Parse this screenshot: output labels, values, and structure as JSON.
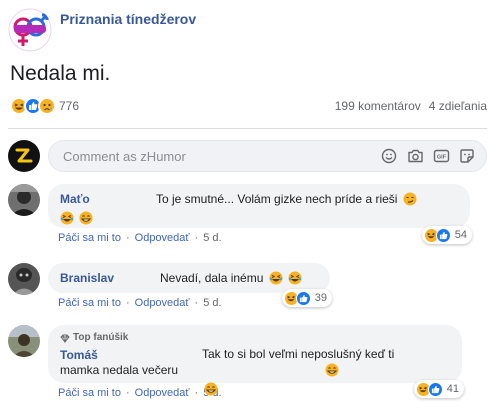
{
  "page": {
    "name": "Priznania tínedžerov",
    "logo_icon": "gender-symbols-logo"
  },
  "post": {
    "text": "Nedala mi.",
    "reaction_icons": [
      "haha-icon",
      "like-icon",
      "sad-icon"
    ],
    "reaction_count": "776",
    "comments_count": "199 komentárov",
    "shares_count": "4 zdieľania"
  },
  "composer": {
    "placeholder": "Comment as zHumor",
    "tools": [
      "emoji-icon",
      "camera-icon",
      "gif-icon",
      "sticker-icon"
    ]
  },
  "comment_actions": {
    "like": "Páči sa mi to",
    "reply": "Odpovedať",
    "dot": "·"
  },
  "comments": [
    {
      "author": "Maťo",
      "badge": "",
      "text": "To je smutné... Volám gizke nech príde a rieši",
      "emojis": [
        "smirk-emoji",
        "laughing-emoji",
        "grin-emoji"
      ],
      "time": "5 d.",
      "reaction_icons": [
        "haha-icon",
        "like-icon"
      ],
      "reaction_count": "54"
    },
    {
      "author": "Branislav",
      "badge": "",
      "text": "Nevadí, dala inému",
      "emojis": [
        "laughing-emoji",
        "laughing-emoji"
      ],
      "time": "5 d.",
      "reaction_icons": [
        "haha-icon",
        "like-icon"
      ],
      "reaction_count": "39"
    },
    {
      "author": "Tomáš",
      "badge": "Top fanúšik",
      "text": "Tak to si bol veľmi neposlušný keď ti mamka nedala večeru",
      "emojis": [
        "grin-emoji",
        "grin-emoji"
      ],
      "time": "5 d.",
      "reaction_icons": [
        "haha-icon",
        "like-icon"
      ],
      "reaction_count": "41"
    }
  ],
  "colors": {
    "link_blue": "#385898",
    "like_blue": "#1877f2",
    "haha_yellow": "#f7b125",
    "bubble_bg": "#f2f3f5"
  }
}
